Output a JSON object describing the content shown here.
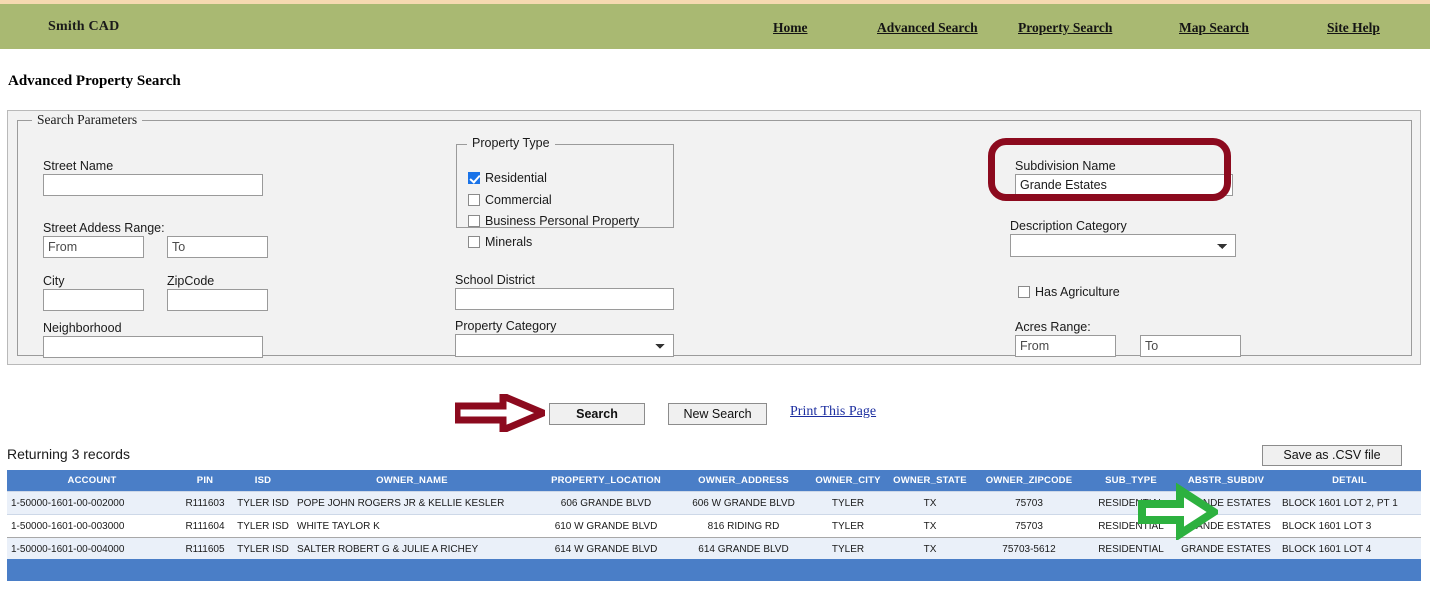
{
  "header": {
    "brand": "Smith CAD",
    "nav": [
      {
        "label": "Home",
        "name": "nav-home"
      },
      {
        "label": "Advanced Search",
        "name": "nav-advanced-search"
      },
      {
        "label": "Property Search",
        "name": "nav-property-search"
      },
      {
        "label": "Map Search",
        "name": "nav-map-search"
      },
      {
        "label": "Site Help",
        "name": "nav-site-help"
      }
    ],
    "bar_color": "#a9b972",
    "top_strip_color": "#f6d9b0"
  },
  "page": {
    "title": "Advanced Property Search"
  },
  "form": {
    "legend": "Search Parameters",
    "street_name": {
      "label": "Street Name",
      "value": "",
      "placeholder": ""
    },
    "street_address_range": {
      "label": "Street Addess Range:",
      "from": {
        "value": "",
        "placeholder": "From"
      },
      "to": {
        "value": "",
        "placeholder": "To"
      }
    },
    "city": {
      "label": "City",
      "value": "",
      "placeholder": ""
    },
    "zipcode": {
      "label": "ZipCode",
      "value": "",
      "placeholder": ""
    },
    "neighborhood": {
      "label": "Neighborhood",
      "value": "",
      "placeholder": ""
    },
    "property_type": {
      "legend": "Property Type",
      "options": [
        {
          "label": "Residential",
          "checked": true
        },
        {
          "label": "Commercial",
          "checked": false
        },
        {
          "label": "Business Personal Property",
          "checked": false
        },
        {
          "label": "Minerals",
          "checked": false
        }
      ]
    },
    "school_district": {
      "label": "School District",
      "value": "",
      "placeholder": ""
    },
    "property_category": {
      "label": "Property Category",
      "selected": "",
      "options": [
        ""
      ]
    },
    "subdivision_name": {
      "label": "Subdivision Name",
      "value": "Grande Estates",
      "placeholder": ""
    },
    "description_category": {
      "label": "Description Category",
      "selected": "",
      "options": [
        ""
      ]
    },
    "has_agriculture": {
      "label": "Has Agriculture",
      "checked": false
    },
    "acres_range": {
      "label": "Acres Range:",
      "from": {
        "value": "",
        "placeholder": "From"
      },
      "to": {
        "value": "",
        "placeholder": "To"
      }
    }
  },
  "actions": {
    "search": "Search",
    "new_search": "New Search",
    "print": "Print This Page",
    "save_csv": "Save as .CSV file"
  },
  "annotations": {
    "subdivision_highlight_color": "#8c0a1e",
    "search_arrow_color": "#8c0a1e",
    "subtype_arrow_color": "#2db13f"
  },
  "results": {
    "count_text": "Returning 3 records",
    "columns": [
      "ACCOUNT",
      "PIN",
      "ISD",
      "OWNER_NAME",
      "PROPERTY_LOCATION",
      "OWNER_ADDRESS",
      "OWNER_CITY",
      "OWNER_STATE",
      "OWNER_ZIPCODE",
      "SUB_TYPE",
      "ABSTR_SUBDIV",
      "DETAIL"
    ],
    "rows": [
      {
        "selected": false,
        "cells": [
          "1-50000-1601-00-002000",
          "R111603",
          "TYLER ISD",
          "POPE JOHN ROGERS JR & KELLIE KESLER",
          "606 GRANDE BLVD",
          "606 W GRANDE BLVD",
          "TYLER",
          "TX",
          "75703",
          "RESIDENTIAL",
          "GRANDE ESTATES",
          "BLOCK 1601 LOT 2, PT 1"
        ]
      },
      {
        "selected": true,
        "cells": [
          "1-50000-1601-00-003000",
          "R111604",
          "TYLER ISD",
          "WHITE TAYLOR K",
          "610 W GRANDE BLVD",
          "816 RIDING RD",
          "TYLER",
          "TX",
          "75703",
          "RESIDENTIAL",
          "GRANDE ESTATES",
          "BLOCK 1601 LOT 3"
        ]
      },
      {
        "selected": false,
        "cells": [
          "1-50000-1601-00-004000",
          "R111605",
          "TYLER ISD",
          "SALTER ROBERT G & JULIE A RICHEY",
          "614 W GRANDE BLVD",
          "614 GRANDE BLVD",
          "TYLER",
          "TX",
          "75703-5612",
          "RESIDENTIAL",
          "GRANDE ESTATES",
          "BLOCK 1601 LOT 4"
        ]
      }
    ],
    "header_color": "#4a7ec7"
  }
}
